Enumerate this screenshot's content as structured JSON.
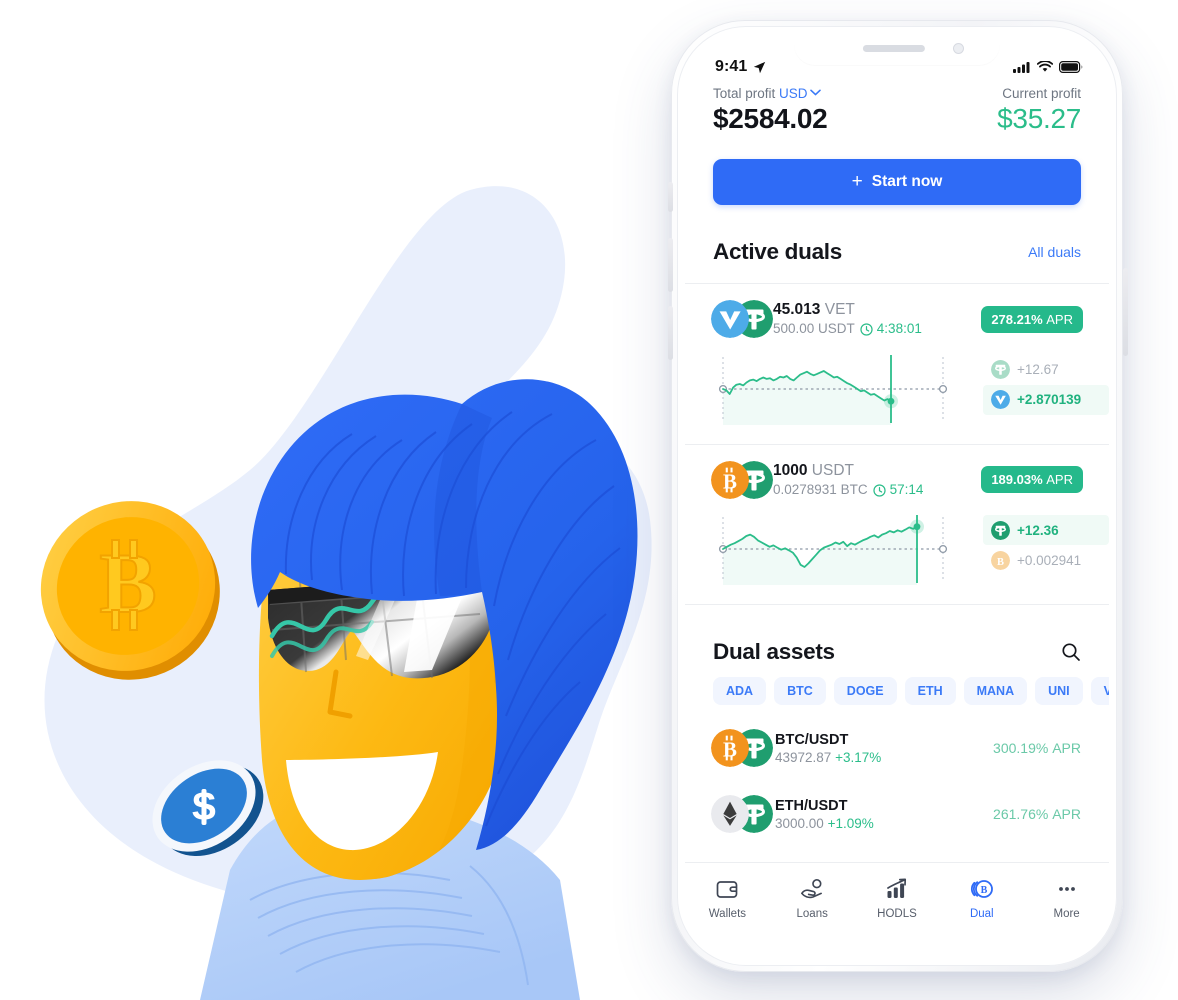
{
  "illustration": {
    "name": "crypto-character-illustration",
    "description": "Yellow character with blue hair and mirrored sunglasses, bitcoin coin and dollar coin",
    "colors": {
      "blob": "#e8eefc",
      "hair": "#2563eb",
      "face": "#fdb913",
      "face_shadow": "#f5a300",
      "bitcoin": "#ffc107",
      "bitcoin_dark": "#f59e00",
      "dollar_coin": "#2b7fd4",
      "dollar_coin_dark": "#1b5fa8",
      "shirt": "#aecbfb"
    }
  },
  "phone": {
    "statusbar": {
      "time": "9:41",
      "location_icon": "location-arrow-icon",
      "signal_icon": "cellular-signal-icon",
      "wifi_icon": "wifi-icon",
      "battery_icon": "battery-icon"
    },
    "header": {
      "total_profit_label": "Total profit",
      "currency": "USD",
      "currency_chevron": "chevron-down-icon",
      "total_profit_value": "$2584.02",
      "current_profit_label": "Current profit",
      "current_profit_value": "$35.27",
      "current_profit_color": "#2bbd8a"
    },
    "start_button": {
      "label": "Start now",
      "plus_icon": "plus-icon",
      "color": "#2f6bf6"
    },
    "active_duals": {
      "title": "Active duals",
      "link": "All duals",
      "cards": [
        {
          "coin_a": "VET",
          "coin_a_icon": "vechain-icon",
          "coin_b": "USDT",
          "coin_b_icon": "tether-icon",
          "amount": "45.013",
          "amount_unit": "VET",
          "secondary": "500.00 USDT",
          "timer_icon": "clock-icon",
          "timer": "4:38:01",
          "apr": "278.21%",
          "apr_suffix": "APR",
          "gains": [
            {
              "icon": "tether-icon",
              "value": "+12.67",
              "style": "muted"
            },
            {
              "icon": "vechain-icon",
              "value": "+2.870139",
              "style": "green"
            }
          ],
          "chart": {
            "type": "line",
            "color": "#2bbd8a",
            "points": [
              50,
              52,
              57,
              48,
              44,
              43,
              45,
              41,
              38,
              37,
              39,
              36,
              34,
              36,
              35,
              38,
              36,
              33,
              34,
              32,
              36,
              38,
              34,
              30,
              28,
              26,
              29,
              31,
              29,
              27,
              25,
              28,
              31,
              34,
              33,
              36,
              39,
              42,
              44,
              47,
              50,
              53,
              52,
              55,
              58,
              57,
              60,
              63,
              66,
              64,
              67
            ],
            "baseline": 50,
            "marker_end": true
          }
        },
        {
          "coin_a": "BTC",
          "coin_a_icon": "bitcoin-icon",
          "coin_b": "USDT",
          "coin_b_icon": "tether-icon",
          "amount": "1000",
          "amount_unit": "USDT",
          "secondary": "0.0278931 BTC",
          "timer_icon": "clock-icon",
          "timer": "57:14",
          "apr": "189.03%",
          "apr_suffix": "APR",
          "gains": [
            {
              "icon": "tether-icon",
              "value": "+12.36",
              "style": "green"
            },
            {
              "icon": "bitcoin-icon",
              "value": "+0.002941",
              "style": "muted"
            }
          ],
          "chart": {
            "type": "line",
            "color": "#2bbd8a",
            "points": [
              50,
              47,
              44,
              42,
              39,
              36,
              32,
              30,
              33,
              38,
              41,
              44,
              47,
              45,
              48,
              51,
              49,
              52,
              55,
              62,
              72,
              75,
              70,
              64,
              58,
              52,
              48,
              46,
              44,
              41,
              43,
              40,
              46,
              42,
              44,
              41,
              38,
              36,
              33,
              31,
              34,
              30,
              28,
              25,
              27,
              24,
              26,
              23,
              20,
              22,
              19
            ],
            "baseline": 50,
            "marker_end": true
          }
        }
      ]
    },
    "dual_assets": {
      "title": "Dual assets",
      "search_icon": "search-icon",
      "filters": [
        "ADA",
        "BTC",
        "DOGE",
        "ETH",
        "MANA",
        "UNI",
        "VET"
      ],
      "rows": [
        {
          "icon_a": "bitcoin-icon",
          "icon_b": "tether-icon",
          "pair": "BTC/USDT",
          "price": "43972.87",
          "change": "+3.17%",
          "apr": "300.19%",
          "apr_suffix": "APR"
        },
        {
          "icon_a": "ethereum-icon",
          "icon_b": "tether-icon",
          "pair": "ETH/USDT",
          "price": "3000.00",
          "change": "+1.09%",
          "apr": "261.76%",
          "apr_suffix": "APR"
        }
      ]
    },
    "tabbar": {
      "items": [
        {
          "icon": "wallet-icon",
          "label": "Wallets",
          "active": false
        },
        {
          "icon": "loans-hand-coin-icon",
          "label": "Loans",
          "active": false
        },
        {
          "icon": "bar-chart-arrow-icon",
          "label": "HODLS",
          "active": false
        },
        {
          "icon": "dual-coins-icon",
          "label": "Dual",
          "active": true
        },
        {
          "icon": "ellipsis-icon",
          "label": "More",
          "active": false
        }
      ],
      "active_color": "#2f6bf6"
    }
  }
}
